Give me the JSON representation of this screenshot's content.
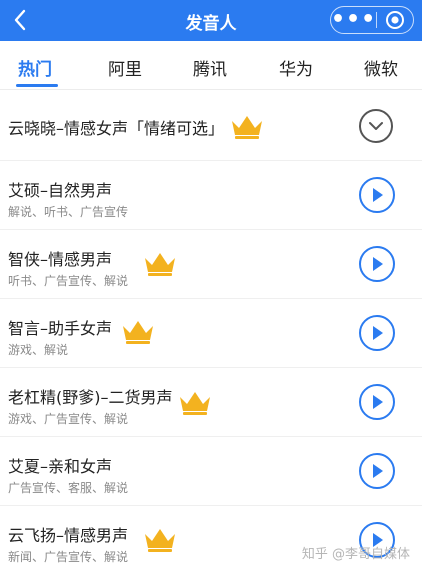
{
  "header": {
    "back_icon": "chevron-left-icon",
    "title": "发音人",
    "more_label": "•••",
    "close_icon": "target-close-icon",
    "bg_color": "#2b7bf0"
  },
  "tabs": [
    {
      "label": "热门",
      "active": true
    },
    {
      "label": "阿里",
      "active": false
    },
    {
      "label": "腾讯",
      "active": false
    },
    {
      "label": "华为",
      "active": false
    },
    {
      "label": "微软",
      "active": false
    }
  ],
  "voices": [
    {
      "name": "云晓晓–情感女声「情绪可选」",
      "tags": "",
      "crown": true,
      "action": "chevron-down-icon"
    },
    {
      "name": "艾硕–自然男声",
      "tags": "解说、听书、广告宣传",
      "crown": false,
      "action": "play-icon"
    },
    {
      "name": "智侠–情感男声",
      "tags": "听书、广告宣传、解说",
      "crown": true,
      "action": "play-icon"
    },
    {
      "name": "智言–助手女声",
      "tags": "游戏、解说",
      "crown": true,
      "action": "play-icon"
    },
    {
      "name": "老杠精(野爹)–二货男声",
      "tags": "游戏、广告宣传、解说",
      "crown": true,
      "action": "play-icon"
    },
    {
      "name": "艾夏–亲和女声",
      "tags": "广告宣传、客服、解说",
      "crown": false,
      "action": "play-icon"
    },
    {
      "name": "云飞扬–情感男声",
      "tags": "新闻、广告宣传、解说",
      "crown": true,
      "action": "play-icon"
    }
  ],
  "watermark": "知乎 @李哥自媒体",
  "colors": {
    "accent": "#2b7bf0",
    "crown": "#f3b21f"
  }
}
